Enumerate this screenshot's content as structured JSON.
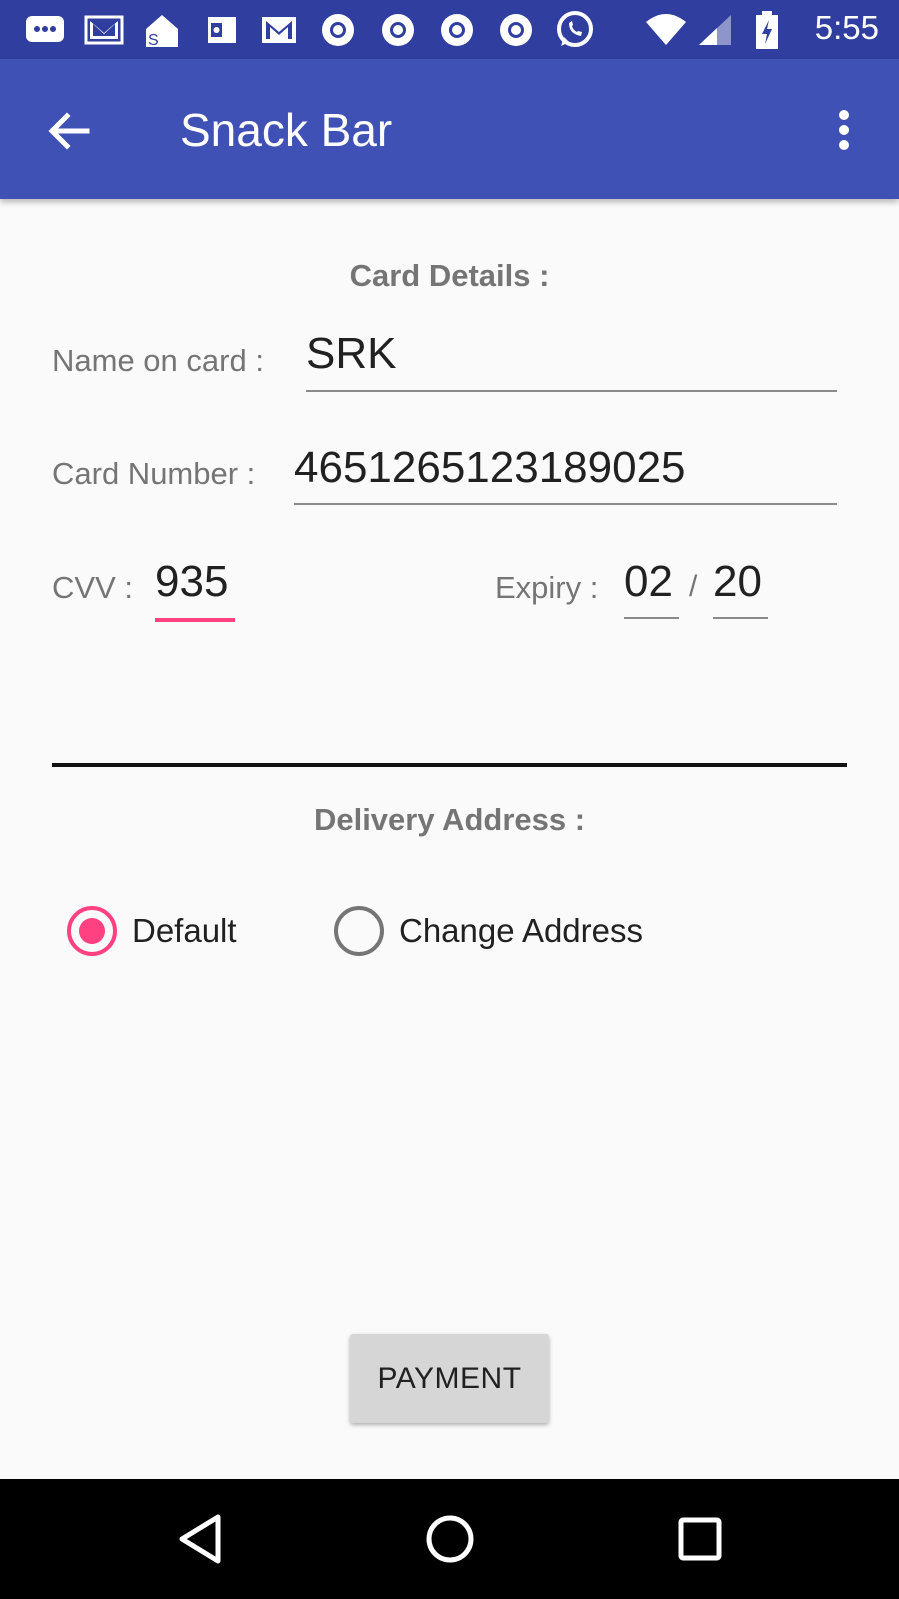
{
  "status_bar": {
    "time": "5:55",
    "icons": [
      "message-icon",
      "gmail-icon",
      "mail-icon",
      "outlook-icon",
      "gmail-icon",
      "chrome-icon",
      "chrome-icon",
      "chrome-icon",
      "chrome-icon",
      "whatsapp-icon",
      "wifi-icon",
      "signal-icon",
      "battery-icon"
    ]
  },
  "app_bar": {
    "title": "Snack Bar",
    "back_icon": "arrow-back-icon",
    "menu_icon": "more-vert-icon"
  },
  "card": {
    "section_title": "Card Details :",
    "name_label": "Name on card :",
    "name_value": "SRK",
    "number_label": "Card Number :",
    "number_value": "4651265123189025",
    "cvv_label": "CVV :",
    "cvv_value": "935",
    "expiry_label": "Expiry :",
    "expiry_month": "02",
    "expiry_separator": "/",
    "expiry_year": "20"
  },
  "delivery": {
    "section_title": "Delivery Address :",
    "options": [
      {
        "label": "Default",
        "checked": true
      },
      {
        "label": "Change Address",
        "checked": false
      }
    ]
  },
  "payment_button": "PAYMENT",
  "colors": {
    "status_bar": "#303f9f",
    "app_bar": "#3f51b5",
    "accent": "#ff4081"
  }
}
